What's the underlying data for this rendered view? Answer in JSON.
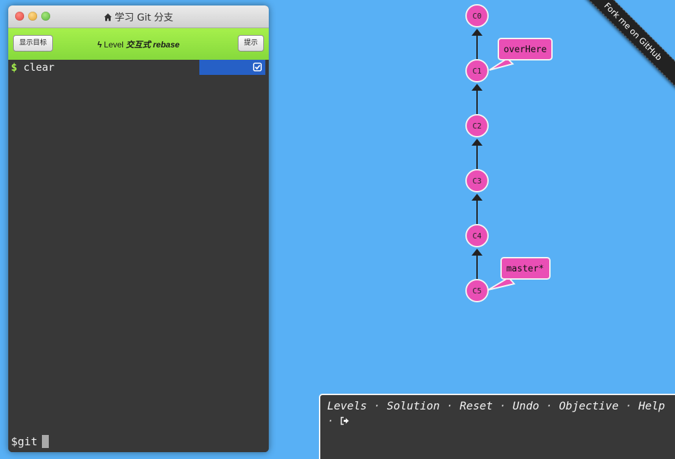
{
  "window": {
    "title": "学习 Git 分支"
  },
  "toolbar": {
    "goal_button": "显示目标",
    "level_prefix": "Level",
    "level_name": "交互式 rebase",
    "hint_button": "提示"
  },
  "terminal": {
    "history": [
      {
        "prompt": "$",
        "command": "clear"
      }
    ],
    "prompt_text": "$git"
  },
  "commits": [
    "C0",
    "C1",
    "C2",
    "C3",
    "C4",
    "C5"
  ],
  "branches": [
    {
      "name": "overHere",
      "target": "C1"
    },
    {
      "name": "master*",
      "target": "C5"
    }
  ],
  "ribbon": {
    "text": "Fork me on GitHub"
  },
  "menu": {
    "items": [
      "Levels",
      "Solution",
      "Reset",
      "Undo",
      "Objective",
      "Help"
    ],
    "separator": "·"
  },
  "colors": {
    "background": "#58b0f5",
    "commit_fill": "#ea4fb5",
    "branch_fill": "#ea4fb5",
    "toolbar_green": "#98e444",
    "terminal_bg": "#383838",
    "status_blue": "#2660c6"
  },
  "icons": {
    "title": "home-icon",
    "level": "lightning-icon",
    "status": "check-square-icon",
    "menu_end": "logout-icon"
  }
}
